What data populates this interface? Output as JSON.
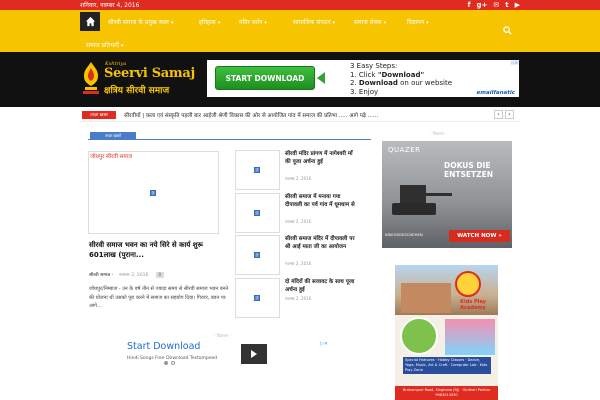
{
  "top_bar": {
    "date": "शनिवार, नवम्बर 4, 2016",
    "social_icons": [
      "facebook-icon",
      "google-plus-icon",
      "mail-icon",
      "twitter-icon",
      "youtube-icon"
    ],
    "social_glyphs": [
      "f",
      "g+",
      "✉",
      "t",
      "▶"
    ]
  },
  "nav": {
    "items_row1": [
      "सीरवी समाज के प्रमुख स्थल",
      "इतिहास",
      "मंदिर दर्शन",
      "सामाजिक संगठन",
      "समाज सेवक",
      "विज्ञापन"
    ],
    "items_row2": [
      "समाज प्रतिभाएँ"
    ],
    "caret": "▾"
  },
  "header": {
    "logo_kshatriya": "Kshtriya",
    "logo_name": "Seervi Samaj",
    "logo_hindi": "क्षत्रिय सीरवी समाज",
    "ad": {
      "button": "START DOWNLOAD",
      "step_title": "3 Easy Steps:",
      "step1_pre": "1. Click ",
      "step1_bold": "\"Download\"",
      "step2_pre": "2. ",
      "step2_bold": "Download",
      "step2_post": " on our website",
      "step3": "3. Enjoy",
      "brand": "emailfanatic",
      "badge": "▷✕"
    }
  },
  "ticker": {
    "label": "ताज़ा ख़बर",
    "text": "सीरवीयों | कला एवं संस्कृति पहली बार आईजी श्रेणी विकास की ओर से आयोजित गांव में समाज की प्रतिभा ..... आगे पढ़े ......",
    "prev": "‹",
    "next": "›"
  },
  "main": {
    "section_label": "ताज़ा ख़बरें",
    "big_caption": "जोधपुर सीरवी समाज",
    "big_title": "सीरवी समाज भवन का नये सिरे से कार्य शुरू 601लाख (पुराना...",
    "author": "सीरवी समाज",
    "date": "नवम्बर 2, 2016",
    "comments": "0",
    "excerpt": "जोधपुर/निम्बाज - उन के वर्ष तीन से ज्यादा समय से सीरवी समाज भवन बनने की योजना थी उसको पूरा करने में समाज का सहयोग दिया। गिरवर, बडन पर आगे...",
    "side_items": [
      {
        "title": "सीरवी मंदिर प्रांगण में नागेश्वरी माँ की पूजा अर्चना हुई",
        "date": "नवम्बर 2, 2016"
      },
      {
        "title": "सीरवी समाज में मनाया गया दीपावली का पर्व गांव में धूमधाम से",
        "date": "नवम्बर 2, 2016"
      },
      {
        "title": "सीरवी समाज मंदिर में दीपावली पर श्री आई माता जी का आयोजन",
        "date": "नवम्बर 2, 2016"
      },
      {
        "title": "दो मंदिरों की सजावट के साथ पूजा अर्चना हुई",
        "date": "नवम्बर 2, 2016"
      }
    ],
    "ad_label": "- विज्ञापन -",
    "bottom_ad": {
      "headline": "Start Download",
      "sub": "Hindi Songs Free Download Testompeed",
      "close": "▷✕"
    }
  },
  "sidebar": {
    "ad_label": "- विज्ञापन -",
    "ad1": {
      "brand": "QUAZER",
      "headline_1": "DOKUS DIE",
      "headline_2": "ENTSETZEN",
      "footer": "KRIEGSGESCHEHEN",
      "cta": "WATCH NOW »"
    },
    "ad2": {
      "kids": "Kids Play Academy",
      "features": "Special Features · Hobby Classes · Dance, Yoga, Music, Art & Craft · Computer Lab · Kids Play Zone",
      "address": "Brahampuri Road, Singhana (RJ) · Girdhari Parihar 9983013030"
    }
  },
  "colors": {
    "top_bar": "#e02b20",
    "nav": "#f6c400",
    "header": "#111111",
    "accent_blue": "#4a7cc7"
  }
}
